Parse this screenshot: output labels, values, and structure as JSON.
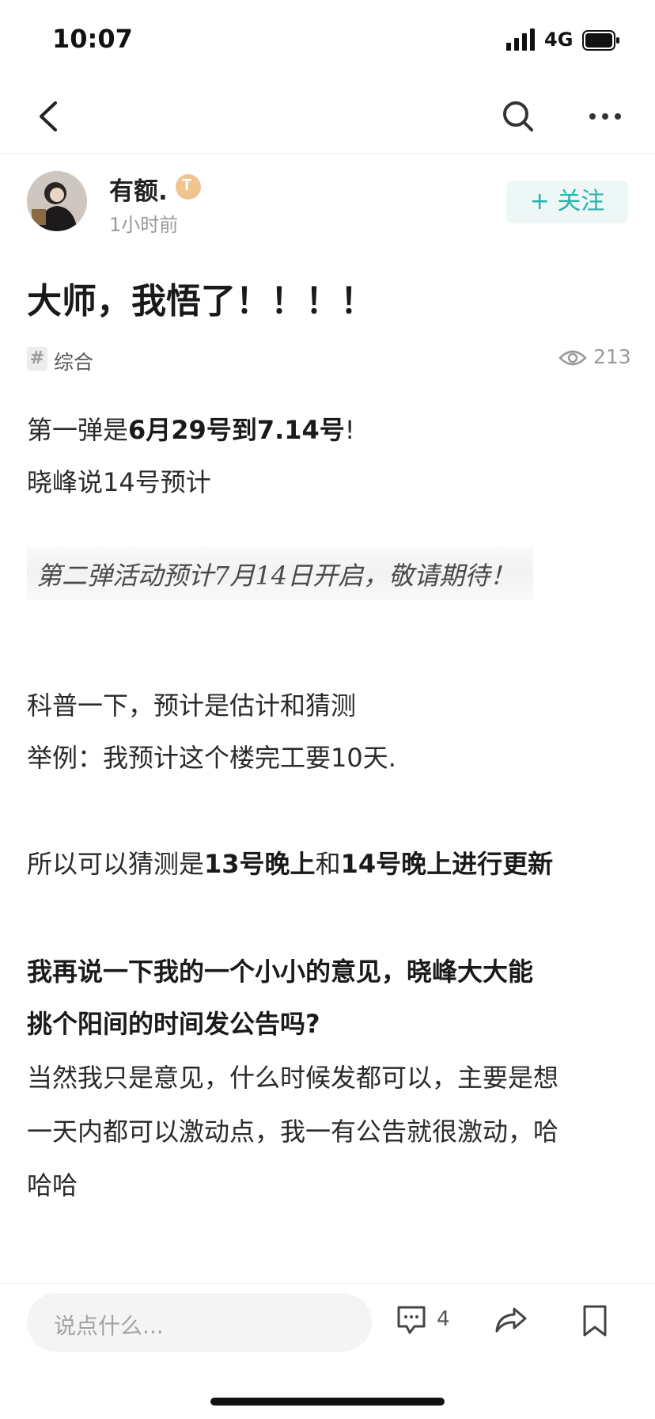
{
  "status_bar": {
    "time": "10:07",
    "network": "4G"
  },
  "author": {
    "name": "有额.",
    "badge_text": "T",
    "time": "1小时前",
    "follow_label": "+ 关注"
  },
  "post": {
    "title": "大师，我悟了！！！！",
    "topic": "综合",
    "views": "213",
    "line1": {
      "a": "第一弹是",
      "b": "6月29号到7.14号",
      "c": "!"
    },
    "line2": "晓峰说14号预计",
    "quote_image_text": "第二弹活动预计7月14日开启，敬请期待！",
    "line3": "科普一下，预计是估计和猜测",
    "line4": "举例：我预计这个楼完工要10天.",
    "line5": {
      "a": "所以可以猜测是",
      "b": "13号晚上",
      "c": "和",
      "d": "14号晚上进行更新"
    },
    "line6": "我再说一下我的一个小小的意见，晓峰大大能",
    "line7": "挑个阳间的时间发公告吗?",
    "line8": "当然我只是意见，什么时候发都可以，主要是想",
    "line9": "一天内都可以激动点，我一有公告就很激动，哈",
    "line10": "哈哈"
  },
  "bottom_bar": {
    "comment_placeholder": "说点什么...",
    "comment_count": "4"
  },
  "colors": {
    "accent": "#2ab2ad",
    "follow_bg": "#edf7f6",
    "muted": "#9a9a9a"
  },
  "icons": {
    "back": "chevron-left-icon",
    "search": "search-icon",
    "more": "more-dots-icon",
    "topic": "hash-icon",
    "views": "eye-icon",
    "comment": "comment-icon",
    "share": "share-icon",
    "bookmark": "bookmark-icon"
  }
}
